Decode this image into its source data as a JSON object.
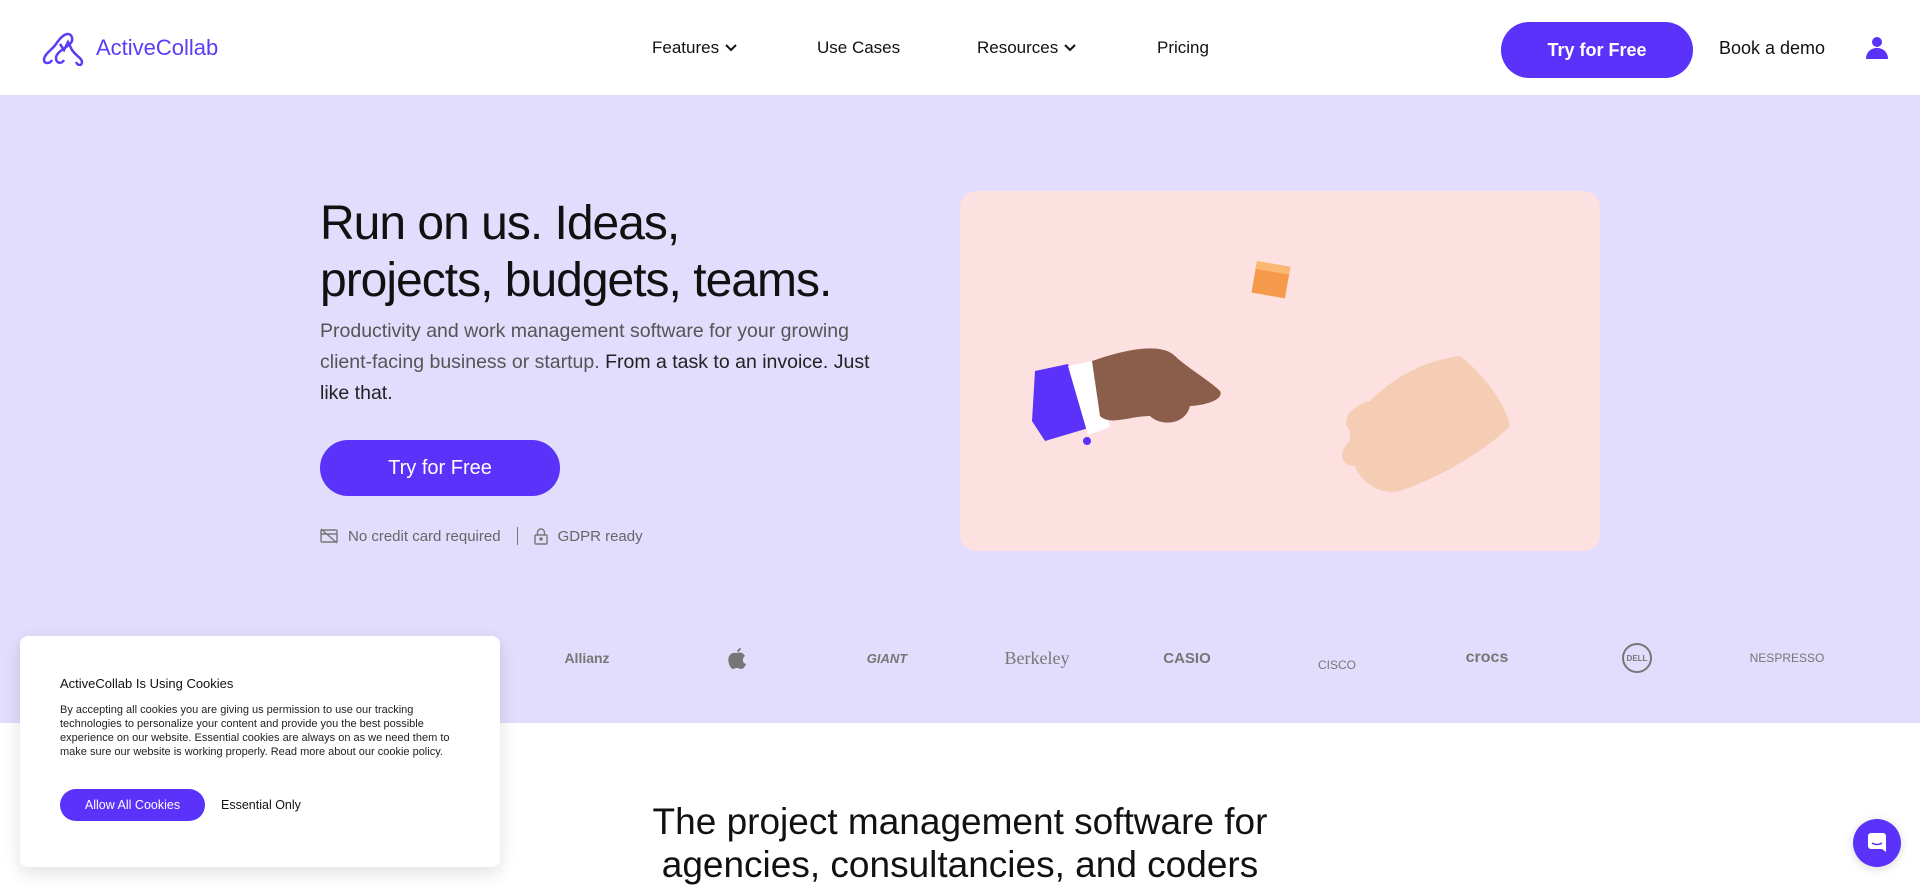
{
  "header": {
    "logo": "ActiveCollab",
    "nav": [
      {
        "label": "Features",
        "dropdown": true
      },
      {
        "label": "Use Cases",
        "dropdown": false
      },
      {
        "label": "Resources",
        "dropdown": true
      },
      {
        "label": "Pricing",
        "dropdown": false
      }
    ],
    "try_label": "Try for Free",
    "demo_label": "Book a demo",
    "user_icon": "user-icon"
  },
  "hero": {
    "title_line1": "Run on us. Ideas,",
    "title_line2": "projects, budgets, teams.",
    "subtitle": "Productivity and work management software for your growing client-facing business or startup.",
    "subtitle_bold": "From a task to an invoice. Just like that.",
    "cta": "Try for Free",
    "badges": [
      {
        "icon": "no-credit-card-icon",
        "label": "No credit card required"
      },
      {
        "icon": "lock-icon",
        "label": "GDPR ready"
      }
    ]
  },
  "logos": [
    "Allianz",
    "Apple",
    "GIANT",
    "Berkeley",
    "CASIO",
    "CISCO",
    "crocs",
    "DELL",
    "NESPRESSO"
  ],
  "cookie": {
    "title": "ActiveCollab Is Using Cookies",
    "body": "By accepting all cookies you are giving us permission to use our tracking technologies to personalize your content and provide you the best possible experience on our website. Essential cookies are always on as we need them to make sure our website is working properly. Read more about our cookie policy.",
    "allow": "Allow All Cookies",
    "essential": "Essential Only"
  },
  "section": {
    "title_line1": "The project management software for",
    "title_line2": "agencies, consultancies, and coders"
  },
  "colors": {
    "accent": "#5a32fa",
    "hero_bg": "#e2dcfd",
    "card_bg": "#fde0e0"
  }
}
